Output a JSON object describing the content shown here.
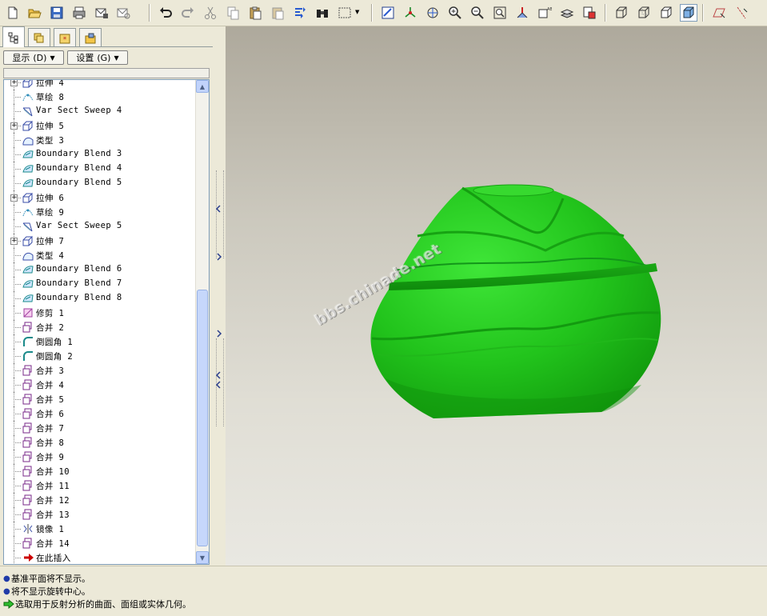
{
  "toolbar": {
    "tools": [
      {
        "id": "new-file",
        "icon": "new-file-icon"
      },
      {
        "id": "open",
        "icon": "open-folder-icon"
      },
      {
        "id": "save",
        "icon": "save-icon"
      },
      {
        "id": "print",
        "icon": "print-icon"
      },
      {
        "id": "email",
        "icon": "email-icon"
      },
      {
        "id": "email-link",
        "icon": "email-link-icon"
      },
      {
        "id": "undo",
        "icon": "undo-icon"
      },
      {
        "id": "redo",
        "icon": "redo-icon"
      },
      {
        "id": "cut",
        "icon": "cut-icon"
      },
      {
        "id": "copy",
        "icon": "copy-icon"
      },
      {
        "id": "paste",
        "icon": "paste-icon"
      },
      {
        "id": "paste-special",
        "icon": "paste-special-icon"
      },
      {
        "id": "regenerate",
        "icon": "regenerate-icon"
      },
      {
        "id": "find",
        "icon": "binoculars-icon"
      },
      {
        "id": "select-box",
        "icon": "selection-box-icon"
      },
      {
        "id": "repaint",
        "icon": "repaint-icon"
      },
      {
        "id": "spin-center",
        "icon": "spin-center-icon"
      },
      {
        "id": "orient",
        "icon": "orient-icon"
      },
      {
        "id": "zoom-in",
        "icon": "zoom-in-icon"
      },
      {
        "id": "zoom-out",
        "icon": "zoom-out-icon"
      },
      {
        "id": "refit",
        "icon": "refit-icon"
      },
      {
        "id": "reorient",
        "icon": "reorient-icon"
      },
      {
        "id": "saved-views",
        "icon": "saved-views-icon"
      },
      {
        "id": "layers",
        "icon": "layers-icon"
      },
      {
        "id": "view-manager",
        "icon": "view-manager-icon"
      },
      {
        "id": "wireframe",
        "icon": "wireframe-icon"
      },
      {
        "id": "hidden-line",
        "icon": "hidden-line-icon"
      },
      {
        "id": "no-hidden",
        "icon": "no-hidden-icon"
      },
      {
        "id": "shading",
        "icon": "shading-icon"
      },
      {
        "id": "datum-planes",
        "icon": "datum-planes-icon"
      },
      {
        "id": "datum-axes",
        "icon": "datum-axes-icon"
      }
    ]
  },
  "panel": {
    "tabs": [
      "model-tree-icon",
      "layer-tree-icon",
      "favorites-icon",
      "folder-browser-icon"
    ],
    "show_menu": "显示",
    "show_key": "(D)",
    "settings_menu": "设置",
    "settings_key": "(G)"
  },
  "tree": {
    "items": [
      {
        "label": "拉伸 4",
        "type": "extrude",
        "expand": true
      },
      {
        "label": "草绘 8",
        "type": "sketch",
        "expand": false
      },
      {
        "label": "Var Sect Sweep 4",
        "type": "sweep",
        "expand": false
      },
      {
        "label": "拉伸 5",
        "type": "extrude",
        "expand": true
      },
      {
        "label": "类型 3",
        "type": "type",
        "expand": false
      },
      {
        "label": "Boundary Blend 3",
        "type": "blend",
        "expand": false
      },
      {
        "label": "Boundary Blend 4",
        "type": "blend",
        "expand": false
      },
      {
        "label": "Boundary Blend 5",
        "type": "blend",
        "expand": false
      },
      {
        "label": "拉伸 6",
        "type": "extrude",
        "expand": true
      },
      {
        "label": "草绘 9",
        "type": "sketch",
        "expand": false
      },
      {
        "label": "Var Sect Sweep 5",
        "type": "sweep",
        "expand": false
      },
      {
        "label": "拉伸 7",
        "type": "extrude",
        "expand": true
      },
      {
        "label": "类型 4",
        "type": "type",
        "expand": false
      },
      {
        "label": "Boundary Blend 6",
        "type": "blend",
        "expand": false
      },
      {
        "label": "Boundary Blend 7",
        "type": "blend",
        "expand": false
      },
      {
        "label": "Boundary Blend 8",
        "type": "blend",
        "expand": false
      },
      {
        "label": "修剪 1",
        "type": "trim",
        "expand": false
      },
      {
        "label": "合并 2",
        "type": "merge",
        "expand": false
      },
      {
        "label": "倒圆角 1",
        "type": "round",
        "expand": false
      },
      {
        "label": "倒圆角 2",
        "type": "round",
        "expand": false
      },
      {
        "label": "合并 3",
        "type": "merge",
        "expand": false
      },
      {
        "label": "合并 4",
        "type": "merge",
        "expand": false
      },
      {
        "label": "合并 5",
        "type": "merge",
        "expand": false
      },
      {
        "label": "合并 6",
        "type": "merge",
        "expand": false
      },
      {
        "label": "合并 7",
        "type": "merge",
        "expand": false
      },
      {
        "label": "合并 8",
        "type": "merge",
        "expand": false
      },
      {
        "label": "合并 9",
        "type": "merge",
        "expand": false
      },
      {
        "label": "合并 10",
        "type": "merge",
        "expand": false
      },
      {
        "label": "合并 11",
        "type": "merge",
        "expand": false
      },
      {
        "label": "合并 12",
        "type": "merge",
        "expand": false
      },
      {
        "label": "合并 13",
        "type": "merge",
        "expand": false
      },
      {
        "label": "镜像 1",
        "type": "mirror",
        "expand": false
      },
      {
        "label": "合并 14",
        "type": "merge",
        "expand": false
      },
      {
        "label": "在此插入",
        "type": "insert",
        "expand": false
      }
    ]
  },
  "viewport": {
    "watermark": "bbs.chinade.net",
    "model_color": "#22c41c"
  },
  "messages": [
    {
      "text": "基准平面将不显示。",
      "kind": "info"
    },
    {
      "text": "将不显示旋转中心。",
      "kind": "info"
    },
    {
      "text": "选取用于反射分析的曲面、面组或实体几何。",
      "kind": "prompt"
    }
  ]
}
